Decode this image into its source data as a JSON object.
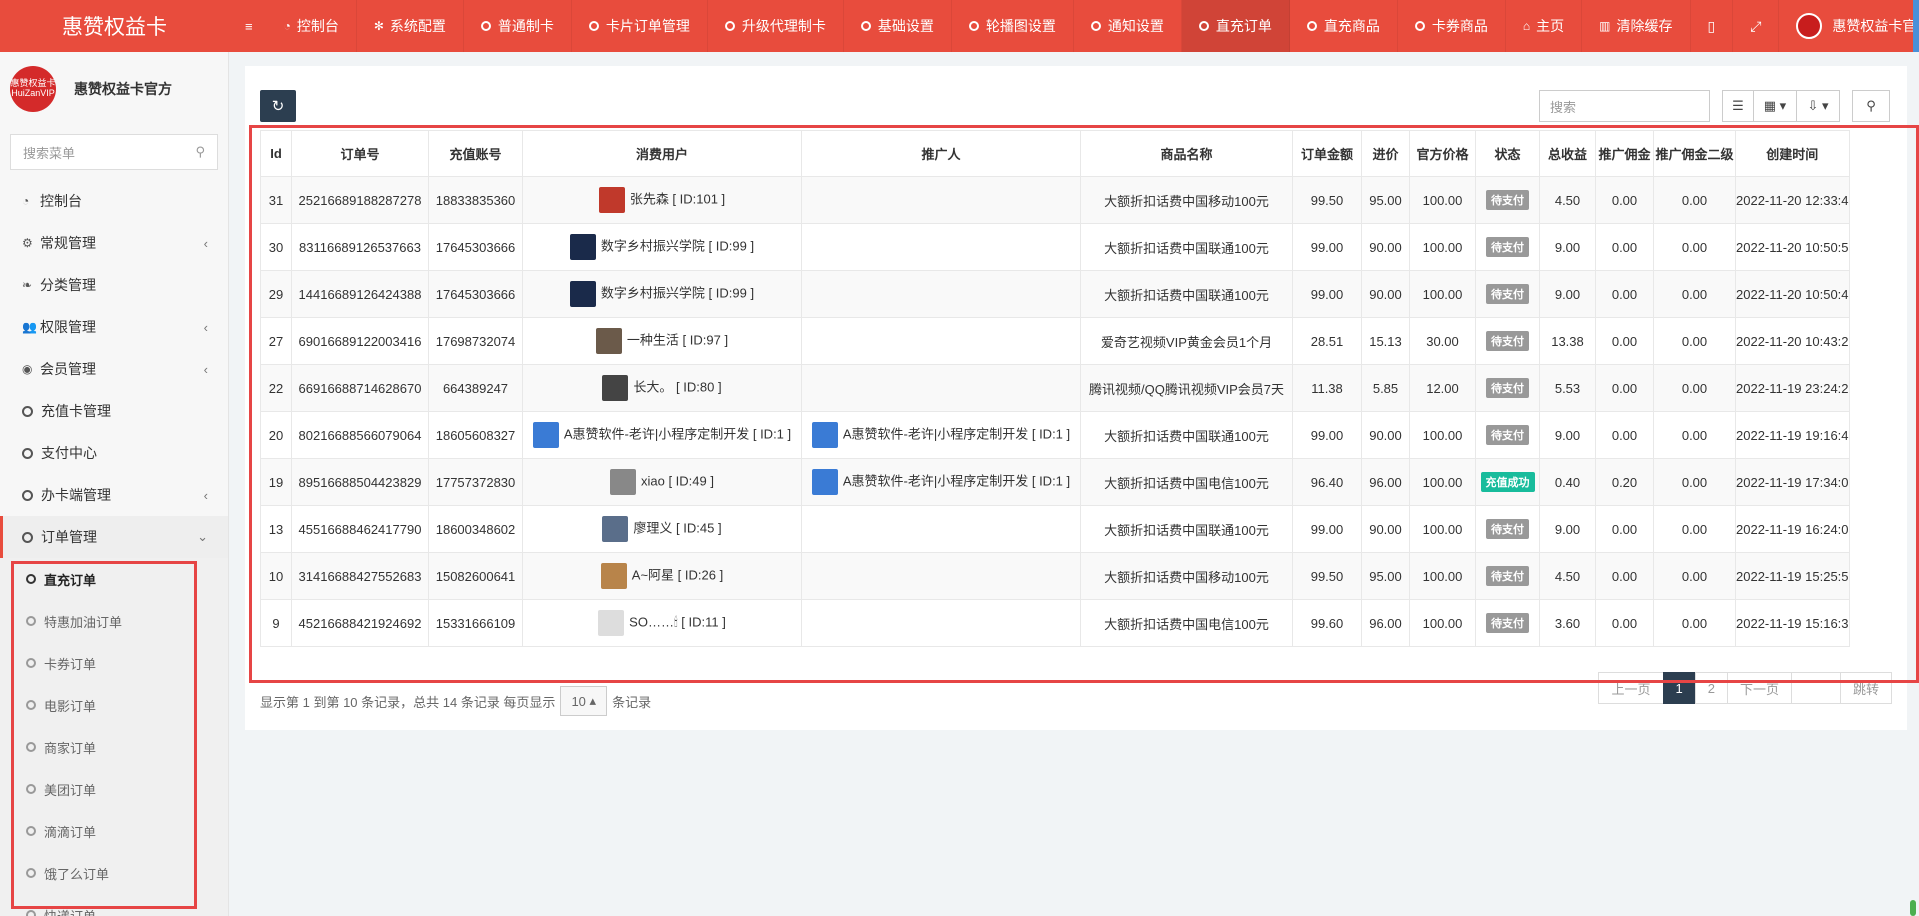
{
  "header": {
    "brand": "惠赞权益卡",
    "menu_toggle_icon": "hamburger-icon",
    "nav": [
      {
        "label": "控制台",
        "icon": "dashboard-icon"
      },
      {
        "label": "系统配置",
        "icon": "gear-icon"
      },
      {
        "label": "普通制卡",
        "icon": "circle-icon"
      },
      {
        "label": "卡片订单管理",
        "icon": "circle-icon"
      },
      {
        "label": "升级代理制卡",
        "icon": "circle-icon"
      },
      {
        "label": "基础设置",
        "icon": "circle-icon"
      },
      {
        "label": "轮播图设置",
        "icon": "circle-icon"
      },
      {
        "label": "通知设置",
        "icon": "circle-icon"
      },
      {
        "label": "直充订单",
        "icon": "circle-icon"
      },
      {
        "label": "直充商品",
        "icon": "circle-icon"
      },
      {
        "label": "卡券商品",
        "icon": "circle-icon"
      },
      {
        "label": "主页",
        "icon": "home-icon"
      },
      {
        "label": "清除缓存",
        "icon": "trash-icon"
      }
    ],
    "account_name": "惠赞权益卡官方",
    "brand_color": "#e84c3d"
  },
  "sidebar": {
    "user_name": "惠赞权益卡官方",
    "avatar_text": "惠赞权益卡 HuiZanVIP",
    "search_placeholder": "搜索菜单",
    "menu": [
      {
        "label": "控制台",
        "icon": "dashboard-icon",
        "arrow": ""
      },
      {
        "label": "常规管理",
        "icon": "cogs-icon",
        "arrow": "‹"
      },
      {
        "label": "分类管理",
        "icon": "leaf-icon",
        "arrow": ""
      },
      {
        "label": "权限管理",
        "icon": "users-icon",
        "arrow": "‹"
      },
      {
        "label": "会员管理",
        "icon": "user-circle-icon",
        "arrow": "‹"
      },
      {
        "label": "充值卡管理",
        "icon": "circle-icon",
        "arrow": ""
      },
      {
        "label": "支付中心",
        "icon": "circle-icon",
        "arrow": ""
      },
      {
        "label": "办卡端管理",
        "icon": "circle-icon",
        "arrow": "‹"
      },
      {
        "label": "订单管理",
        "icon": "circle-icon",
        "arrow": "⌄"
      }
    ],
    "submenu": [
      {
        "label": "直充订单"
      },
      {
        "label": "特惠加油订单"
      },
      {
        "label": "卡券订单"
      },
      {
        "label": "电影订单"
      },
      {
        "label": "商家订单"
      },
      {
        "label": "美团订单"
      },
      {
        "label": "滴滴订单"
      },
      {
        "label": "饿了么订单"
      },
      {
        "label": "快递订单"
      }
    ]
  },
  "toolbar": {
    "search_placeholder": "搜索"
  },
  "table": {
    "columns": [
      "Id",
      "订单号",
      "充值账号",
      "消费用户",
      "推广人",
      "商品名称",
      "订单金额",
      "进价",
      "官方价格",
      "状态",
      "总收益",
      "推广佣金",
      "推广佣金二级",
      "创建时间"
    ],
    "rows": [
      {
        "id": "31",
        "order_no": "25216689188287278",
        "account": "18833835360",
        "user": "张先森 [ ID:101 ]",
        "user_avatar": "#c0392b",
        "promoter": "",
        "product": "大额折扣话费中国移动100元",
        "amount": "99.50",
        "cost": "95.00",
        "price": "100.00",
        "status": "待支付",
        "profit": "4.50",
        "commission": "0.00",
        "commission2": "0.00",
        "created": "2022-11-20 12:33:4"
      },
      {
        "id": "30",
        "order_no": "83116689126537663",
        "account": "17645303666",
        "user": "数字乡村振兴学院 [ ID:99 ]",
        "user_avatar": "#1a2a4a",
        "promoter": "",
        "product": "大额折扣话费中国联通100元",
        "amount": "99.00",
        "cost": "90.00",
        "price": "100.00",
        "status": "待支付",
        "profit": "9.00",
        "commission": "0.00",
        "commission2": "0.00",
        "created": "2022-11-20 10:50:5"
      },
      {
        "id": "29",
        "order_no": "14416689126424388",
        "account": "17645303666",
        "user": "数字乡村振兴学院 [ ID:99 ]",
        "user_avatar": "#1a2a4a",
        "promoter": "",
        "product": "大额折扣话费中国联通100元",
        "amount": "99.00",
        "cost": "90.00",
        "price": "100.00",
        "status": "待支付",
        "profit": "9.00",
        "commission": "0.00",
        "commission2": "0.00",
        "created": "2022-11-20 10:50:4"
      },
      {
        "id": "27",
        "order_no": "69016689122003416",
        "account": "17698732074",
        "user": "一种生活 [ ID:97 ]",
        "user_avatar": "#6b5a4a",
        "promoter": "",
        "product": "爱奇艺视频VIP黄金会员1个月",
        "amount": "28.51",
        "cost": "15.13",
        "price": "30.00",
        "status": "待支付",
        "profit": "13.38",
        "commission": "0.00",
        "commission2": "0.00",
        "created": "2022-11-20 10:43:2"
      },
      {
        "id": "22",
        "order_no": "66916688714628670",
        "account": "664389247",
        "user": "长大。 [ ID:80 ]",
        "user_avatar": "#444444",
        "promoter": "",
        "product": "腾讯视频/QQ腾讯视频VIP会员7天",
        "amount": "11.38",
        "cost": "5.85",
        "price": "12.00",
        "status": "待支付",
        "profit": "5.53",
        "commission": "0.00",
        "commission2": "0.00",
        "created": "2022-11-19 23:24:2"
      },
      {
        "id": "20",
        "order_no": "80216688566079064",
        "account": "18605608327",
        "user": "A惠赞软件-老许|小程序定制开发 [ ID:1 ]",
        "user_avatar": "#3a7bd5",
        "promoter": "A惠赞软件-老许|小程序定制开发 [ ID:1 ]",
        "product": "大额折扣话费中国联通100元",
        "amount": "99.00",
        "cost": "90.00",
        "price": "100.00",
        "status": "待支付",
        "profit": "9.00",
        "commission": "0.00",
        "commission2": "0.00",
        "created": "2022-11-19 19:16:4"
      },
      {
        "id": "19",
        "order_no": "89516688504423829",
        "account": "17757372830",
        "user": "xiao [ ID:49 ]",
        "user_avatar": "#888888",
        "promoter": "A惠赞软件-老许|小程序定制开发 [ ID:1 ]",
        "product": "大额折扣话费中国电信100元",
        "amount": "96.40",
        "cost": "96.00",
        "price": "100.00",
        "status": "充值成功",
        "profit": "0.40",
        "commission": "0.20",
        "commission2": "0.00",
        "created": "2022-11-19 17:34:0"
      },
      {
        "id": "13",
        "order_no": "45516688462417790",
        "account": "18600348602",
        "user": "廖理义 [ ID:45 ]",
        "user_avatar": "#5a6e8a",
        "promoter": "",
        "product": "大额折扣话费中国联通100元",
        "amount": "99.00",
        "cost": "90.00",
        "price": "100.00",
        "status": "待支付",
        "profit": "9.00",
        "commission": "0.00",
        "commission2": "0.00",
        "created": "2022-11-19 16:24:0"
      },
      {
        "id": "10",
        "order_no": "31416688427552683",
        "account": "15082600641",
        "user": "A~阿星 [ ID:26 ]",
        "user_avatar": "#b8844a",
        "promoter": "",
        "product": "大额折扣话费中国移动100元",
        "amount": "99.50",
        "cost": "95.00",
        "price": "100.00",
        "status": "待支付",
        "profit": "4.50",
        "commission": "0.00",
        "commission2": "0.00",
        "created": "2022-11-19 15:25:5"
      },
      {
        "id": "9",
        "order_no": "45216688421924692",
        "account": "15331666109",
        "user": "SO……🕯 [ ID:11 ]",
        "user_avatar": "#dddddd",
        "promoter": "",
        "product": "大额折扣话费中国电信100元",
        "amount": "99.60",
        "cost": "96.00",
        "price": "100.00",
        "status": "待支付",
        "profit": "3.60",
        "commission": "0.00",
        "commission2": "0.00",
        "created": "2022-11-19 15:16:3"
      }
    ]
  },
  "footer": {
    "info_prefix": "显示第 1 到第 10 条记录，总共 14 条记录 每页显示",
    "page_size": "10",
    "info_suffix": "条记录",
    "prev": "上一页",
    "pages": [
      "1",
      "2"
    ],
    "next": "下一页",
    "jump": "跳转"
  },
  "colors": {
    "pending_badge": "#999999",
    "success_badge": "#18bc9c",
    "highlight_box": "#e64545"
  }
}
